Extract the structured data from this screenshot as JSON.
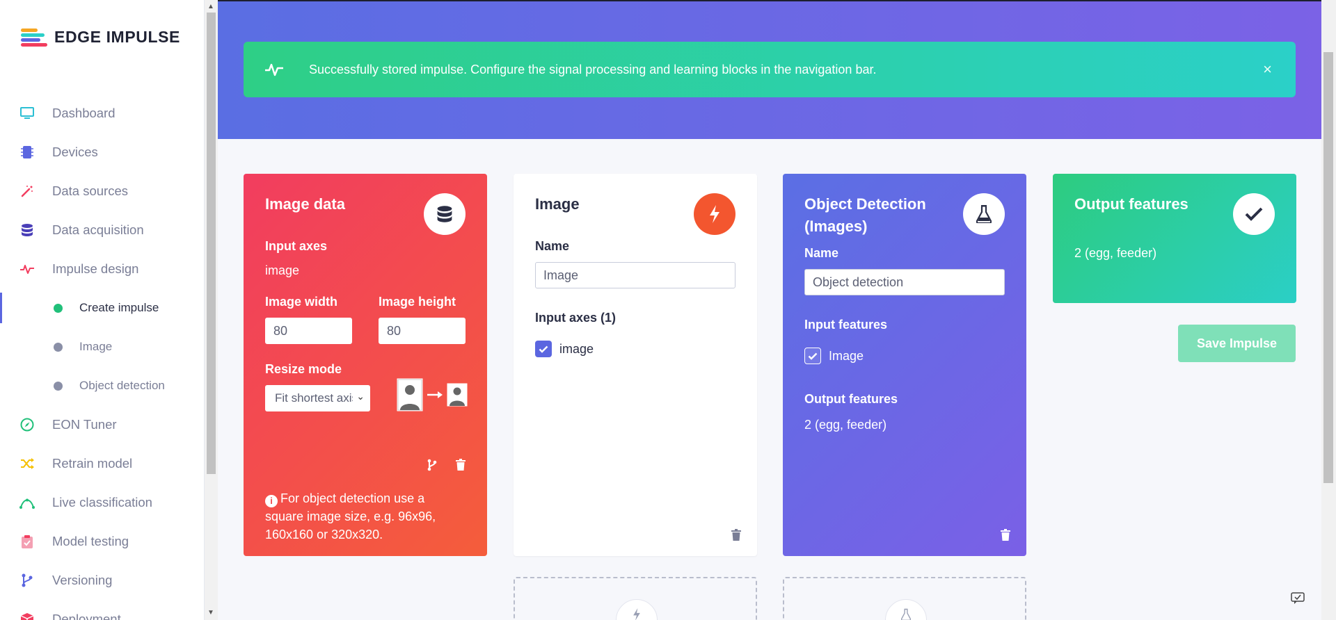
{
  "brand": {
    "name": "EDGE IMPULSE",
    "logo_colors": [
      "#f5a623",
      "#21c07a",
      "#5b66e0",
      "#2bd0c8",
      "#f23d5f"
    ]
  },
  "nav": {
    "items": [
      {
        "label": "Dashboard",
        "icon": "monitor-icon",
        "color": "#2bbfd4"
      },
      {
        "label": "Devices",
        "icon": "chip-icon",
        "color": "#5b66e0"
      },
      {
        "label": "Data sources",
        "icon": "magic-wand-icon",
        "color": "#f23d5f"
      },
      {
        "label": "Data acquisition",
        "icon": "database-icon",
        "color": "#4a3fb8"
      },
      {
        "label": "Impulse design",
        "icon": "pulse-icon",
        "color": "#f23d5f"
      }
    ],
    "sub_items": [
      {
        "label": "Create impulse",
        "active": true
      },
      {
        "label": "Image",
        "active": false
      },
      {
        "label": "Object detection",
        "active": false
      }
    ],
    "items_after": [
      {
        "label": "EON Tuner",
        "icon": "compass-icon",
        "color": "#21c07a"
      },
      {
        "label": "Retrain model",
        "icon": "shuffle-icon",
        "color": "#f5c000"
      },
      {
        "label": "Live classification",
        "icon": "curve-icon",
        "color": "#21c07a"
      },
      {
        "label": "Model testing",
        "icon": "clipboard-check-icon",
        "color": "#f23d5f"
      },
      {
        "label": "Versioning",
        "icon": "branch-icon",
        "color": "#5b66e0"
      },
      {
        "label": "Deployment",
        "icon": "box-icon",
        "color": "#f23d5f"
      }
    ]
  },
  "alert": {
    "message": "Successfully stored impulse. Configure the signal processing and learning blocks in the navigation bar.",
    "close": "×"
  },
  "image_data_card": {
    "title": "Image data",
    "input_axes_label": "Input axes",
    "input_axes_value": "image",
    "width_label": "Image width",
    "width_value": "80",
    "height_label": "Image height",
    "height_value": "80",
    "resize_label": "Resize mode",
    "resize_selected": "Fit shortest axis",
    "note": "For object detection use a square image size, e.g. 96x96, 160x160 or 320x320."
  },
  "image_card": {
    "title": "Image",
    "name_label": "Name",
    "name_value": "Image",
    "input_axes_label": "Input axes (1)",
    "axis_checkbox_label": "image",
    "axis_checked": true
  },
  "od_card": {
    "title": "Object Detection (Images)",
    "name_label": "Name",
    "name_value": "Object detection",
    "input_features_label": "Input features",
    "feature_checkbox_label": "Image",
    "feature_checked": true,
    "output_features_label": "Output features",
    "output_features_value": "2 (egg, feeder)"
  },
  "output_card": {
    "title": "Output features",
    "value": "2 (egg, feeder)"
  },
  "save_button": "Save Impulse"
}
